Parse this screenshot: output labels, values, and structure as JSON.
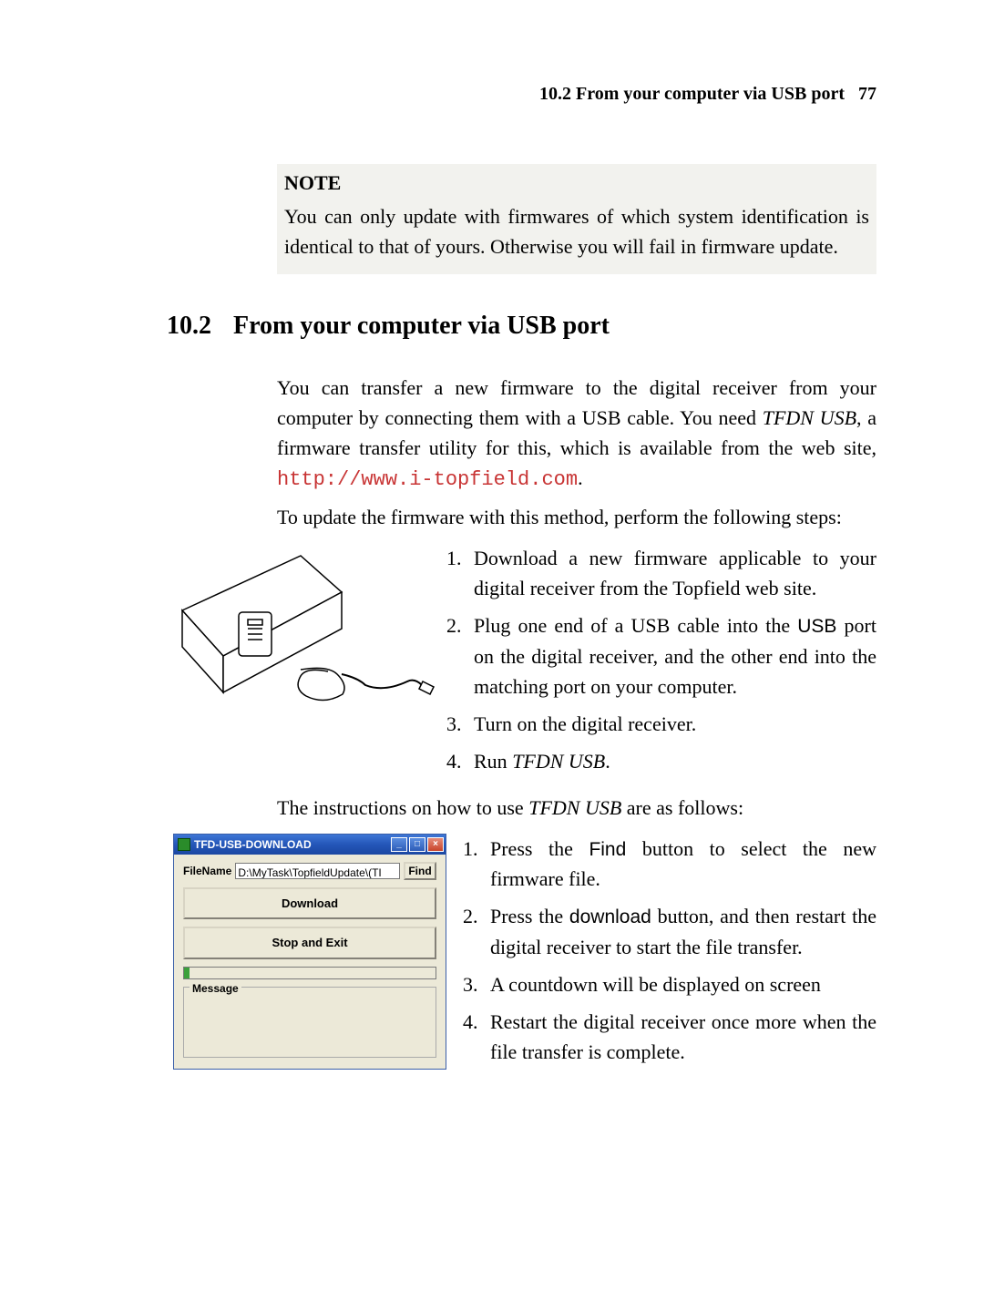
{
  "header": {
    "section_ref": "10.2 From your computer via USB port",
    "page_number": "77"
  },
  "note": {
    "label": "NOTE",
    "text": "You can only update with firmwares of which system identification is identical to that of yours. Otherwise you will fail in firmware update."
  },
  "section": {
    "number": "10.2",
    "title": "From your computer via USB port"
  },
  "intro": {
    "p1_a": "You can transfer a new firmware to the digital receiver from your computer by connecting them with a USB cable. You need ",
    "p1_italic": "TFDN USB",
    "p1_b": ", a firmware transfer utility for this, which is available from the web site, ",
    "p1_url": "http://www.i-topfield.com",
    "p1_c": ".",
    "p2": "To update the firmware with this method, perform the following steps:"
  },
  "steps_a": {
    "s1": "Download a new firmware applicable to your digital receiver from the Topfield web site.",
    "s2_a": "Plug one end of a USB cable into the ",
    "s2_usb": "USB",
    "s2_b": " port on the digital receiver, and the other end into the matching port on your computer.",
    "s3": "Turn on the digital receiver.",
    "s4_a": "Run ",
    "s4_it": "TFDN USB",
    "s4_b": "."
  },
  "mid_line_a": "The instructions on how to use ",
  "mid_line_it": "TFDN USB",
  "mid_line_b": " are as follows:",
  "tfd_window": {
    "title": "TFD-USB-DOWNLOAD",
    "file_label": "FileName",
    "file_value": "D:\\MyTask\\TopfieldUpdate\\(TI",
    "find_btn": "Find",
    "download_btn": "Download",
    "stop_btn": "Stop and Exit",
    "message_label": "Message"
  },
  "steps_b": {
    "s1_a": "Press the ",
    "s1_find": "Find",
    "s1_b": " button to select the new firmware file.",
    "s2_a": "Press the ",
    "s2_dl": "download",
    "s2_b": " button, and then restart the digital receiver to start the file transfer.",
    "s3": "A countdown will be displayed on screen",
    "s4": "Restart the digital receiver once more when the file transfer is complete."
  }
}
